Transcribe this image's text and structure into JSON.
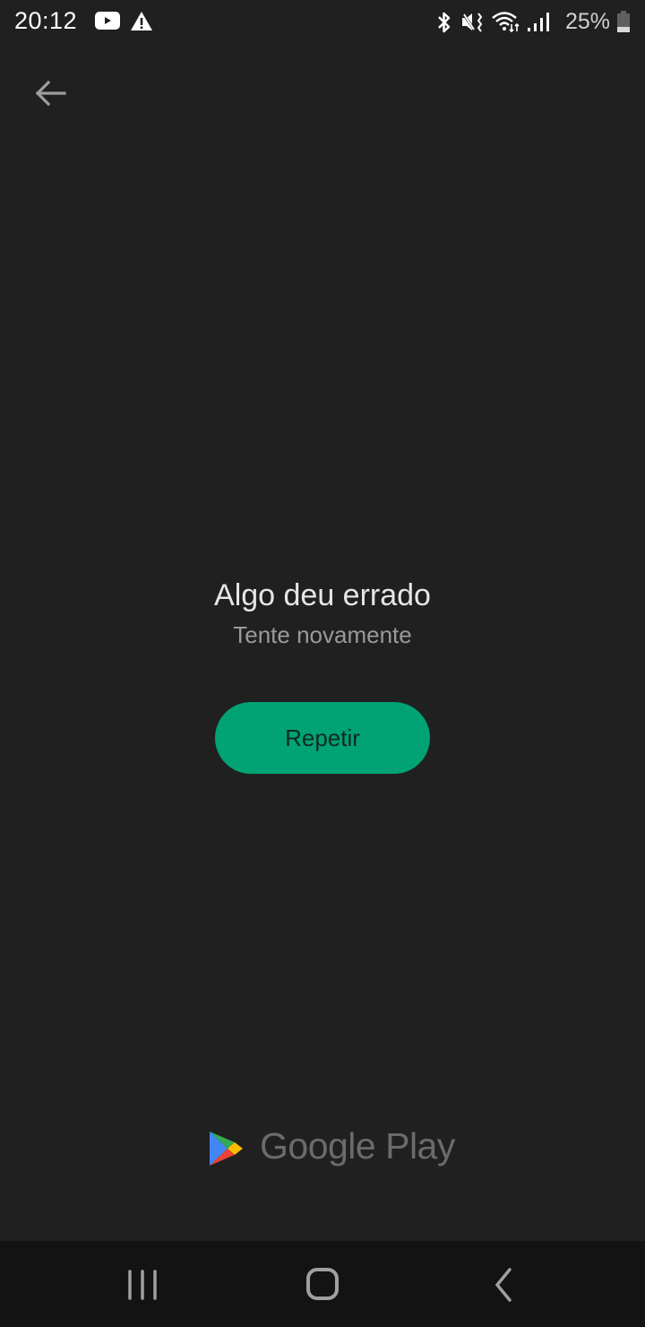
{
  "status_bar": {
    "time": "20:12",
    "left_icons": [
      "youtube-icon",
      "warning-icon"
    ],
    "right_icons": [
      "bluetooth-icon",
      "mute-vibrate-icon",
      "wifi-icon",
      "signal-icon",
      "battery-icon"
    ],
    "battery_percent": "25%",
    "battery_level": 0.25
  },
  "toolbar": {
    "back_icon": "arrow-left-icon"
  },
  "error": {
    "title": "Algo deu errado",
    "subtitle": "Tente novamente",
    "retry_label": "Repetir"
  },
  "branding": {
    "logo_text": "Google Play"
  },
  "nav_bar": {
    "buttons": [
      "recents",
      "home",
      "back"
    ]
  },
  "colors": {
    "background": "#202020",
    "accent": "#01a274",
    "nav_bg": "#131313"
  }
}
